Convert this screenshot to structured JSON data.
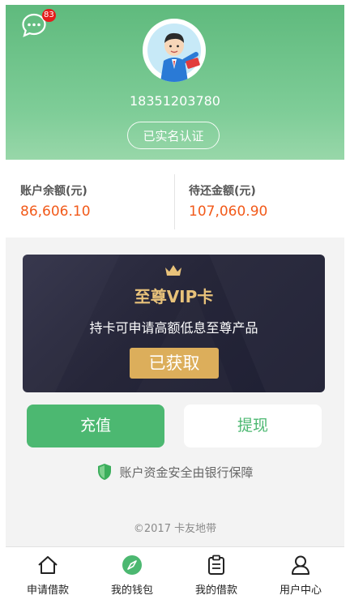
{
  "header": {
    "message_badge": "83",
    "phone": "18351203780",
    "verify_label": "已实名认证"
  },
  "balances": {
    "account_label": "账户余额(元)",
    "account_value": "86,606.10",
    "due_label": "待还金额(元)",
    "due_value": "107,060.90"
  },
  "vip_card": {
    "title": "至尊VIP卡",
    "subtitle": "持卡可申请高额低息至尊产品",
    "button": "已获取"
  },
  "actions": {
    "recharge": "充值",
    "withdraw": "提现"
  },
  "security_note": "账户资金安全由银行保障",
  "copyright": "©2017 卡友地带",
  "tabbar": [
    {
      "label": "申请借款",
      "icon": "home-icon"
    },
    {
      "label": "我的钱包",
      "icon": "compass-icon"
    },
    {
      "label": "我的借款",
      "icon": "clipboard-icon"
    },
    {
      "label": "用户中心",
      "icon": "user-icon"
    }
  ],
  "colors": {
    "brand_green": "#4cb871",
    "amount_orange": "#f25a1a",
    "vip_gold": "#dcae5b",
    "badge_red": "#e51c1c"
  }
}
